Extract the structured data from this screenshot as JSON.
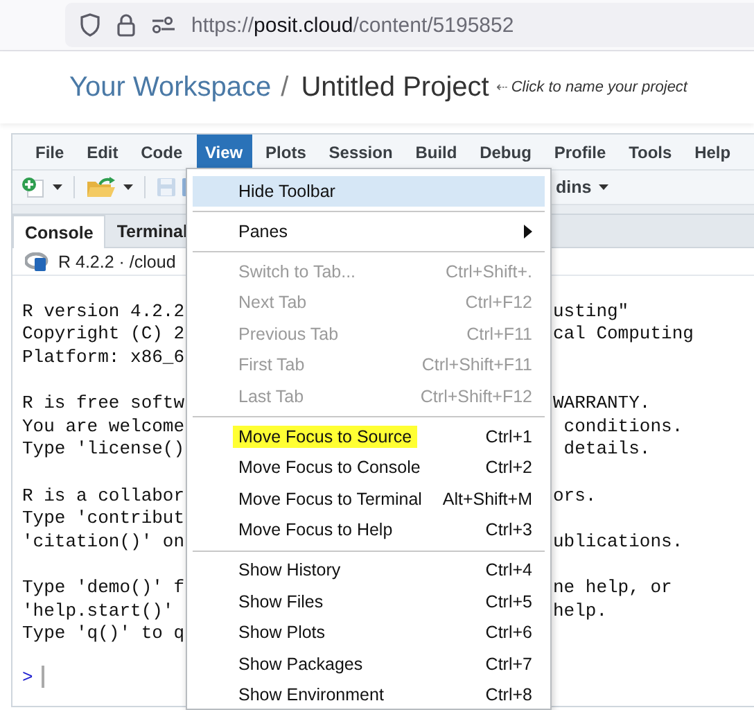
{
  "browser": {
    "url": {
      "scheme": "https://",
      "host": "posit.cloud",
      "path": "/content/5195852"
    }
  },
  "header": {
    "workspace": "Your Workspace",
    "separator": "/",
    "project": "Untitled Project",
    "hint_arrow": "⇠",
    "hint": "Click to name your project"
  },
  "menubar": [
    {
      "label": "File",
      "selected": false
    },
    {
      "label": "Edit",
      "selected": false
    },
    {
      "label": "Code",
      "selected": false
    },
    {
      "label": "View",
      "selected": true
    },
    {
      "label": "Plots",
      "selected": false
    },
    {
      "label": "Session",
      "selected": false
    },
    {
      "label": "Build",
      "selected": false
    },
    {
      "label": "Debug",
      "selected": false
    },
    {
      "label": "Profile",
      "selected": false
    },
    {
      "label": "Tools",
      "selected": false
    },
    {
      "label": "Help",
      "selected": false
    }
  ],
  "toolbar": {
    "addins_label": "dins"
  },
  "pane_tabs": [
    {
      "label": "Console",
      "selected": true
    },
    {
      "label": "Terminal",
      "selected": false
    }
  ],
  "console_path": "R 4.2.2 · /cloud",
  "console_lines": [
    {
      "kind": "text",
      "left": "R version 4.2.2",
      "right": "usting\""
    },
    {
      "kind": "text",
      "left": "Copyright (C) 2",
      "right": "cal Computing"
    },
    {
      "kind": "text",
      "left": "Platform: x86_6"
    },
    {
      "kind": "blank"
    },
    {
      "kind": "text",
      "left": "R is free softw",
      "right": "WARRANTY."
    },
    {
      "kind": "text",
      "left": "You are welcome",
      "right": " conditions."
    },
    {
      "kind": "text",
      "left": "Type 'license()",
      "right": " details."
    },
    {
      "kind": "blank"
    },
    {
      "kind": "text",
      "left": "R is a collabor",
      "right": "ors."
    },
    {
      "kind": "text",
      "left": "Type 'contribut"
    },
    {
      "kind": "text",
      "left": "'citation()' on",
      "right": "ublications."
    },
    {
      "kind": "blank"
    },
    {
      "kind": "text",
      "left": "Type 'demo()' f",
      "right": "ne help, or"
    },
    {
      "kind": "text",
      "left": "'help.start()'",
      "right": "help."
    },
    {
      "kind": "text",
      "left": "Type 'q()' to q"
    }
  ],
  "prompt": ">",
  "menu": [
    {
      "kind": "item",
      "label": "Hide Toolbar",
      "disabled": false,
      "hovered": true,
      "highlighted": false
    },
    {
      "kind": "separator"
    },
    {
      "kind": "submenu",
      "label": "Panes",
      "disabled": false,
      "hovered": false,
      "highlighted": false
    },
    {
      "kind": "separator"
    },
    {
      "kind": "item",
      "label": "Switch to Tab...",
      "shortcut": "Ctrl+Shift+.",
      "disabled": true,
      "hovered": false,
      "highlighted": false
    },
    {
      "kind": "item",
      "label": "Next Tab",
      "shortcut": "Ctrl+F12",
      "disabled": true,
      "hovered": false,
      "highlighted": false
    },
    {
      "kind": "item",
      "label": "Previous Tab",
      "shortcut": "Ctrl+F11",
      "disabled": true,
      "hovered": false,
      "highlighted": false
    },
    {
      "kind": "item",
      "label": "First Tab",
      "shortcut": "Ctrl+Shift+F11",
      "disabled": true,
      "hovered": false,
      "highlighted": false
    },
    {
      "kind": "item",
      "label": "Last Tab",
      "shortcut": "Ctrl+Shift+F12",
      "disabled": true,
      "hovered": false,
      "highlighted": false
    },
    {
      "kind": "separator"
    },
    {
      "kind": "item",
      "label": "Move Focus to Source",
      "shortcut": "Ctrl+1",
      "disabled": false,
      "hovered": false,
      "highlighted": true
    },
    {
      "kind": "item",
      "label": "Move Focus to Console",
      "shortcut": "Ctrl+2",
      "disabled": false,
      "hovered": false,
      "highlighted": false
    },
    {
      "kind": "item",
      "label": "Move Focus to Terminal",
      "shortcut": "Alt+Shift+M",
      "disabled": false,
      "hovered": false,
      "highlighted": false
    },
    {
      "kind": "item",
      "label": "Move Focus to Help",
      "shortcut": "Ctrl+3",
      "disabled": false,
      "hovered": false,
      "highlighted": false
    },
    {
      "kind": "separator"
    },
    {
      "kind": "item",
      "label": "Show History",
      "shortcut": "Ctrl+4",
      "disabled": false,
      "hovered": false,
      "highlighted": false
    },
    {
      "kind": "item",
      "label": "Show Files",
      "shortcut": "Ctrl+5",
      "disabled": false,
      "hovered": false,
      "highlighted": false
    },
    {
      "kind": "item",
      "label": "Show Plots",
      "shortcut": "Ctrl+6",
      "disabled": false,
      "hovered": false,
      "highlighted": false
    },
    {
      "kind": "item",
      "label": "Show Packages",
      "shortcut": "Ctrl+7",
      "disabled": false,
      "hovered": false,
      "highlighted": false
    },
    {
      "kind": "item",
      "label": "Show Environment",
      "shortcut": "Ctrl+8",
      "disabled": false,
      "hovered": false,
      "highlighted": false
    }
  ]
}
